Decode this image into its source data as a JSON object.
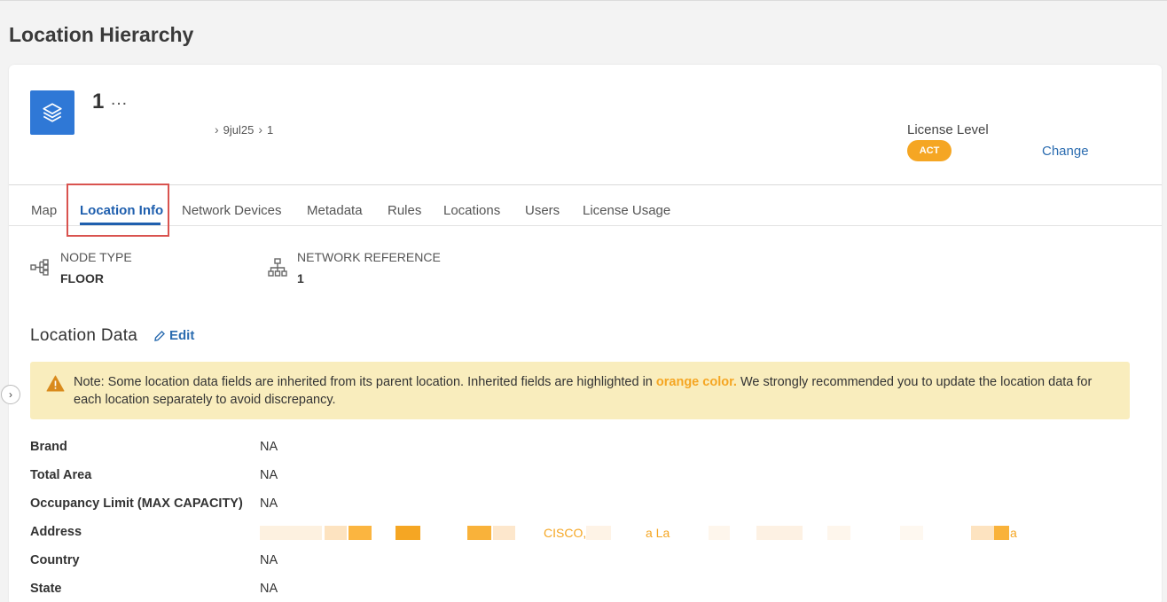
{
  "page": {
    "title": "Location Hierarchy"
  },
  "location": {
    "name": "1",
    "more_label": "…",
    "breadcrumb": [
      "9jul25",
      "1"
    ],
    "icon": "layers-icon"
  },
  "license": {
    "label": "License Level",
    "badge": "ACT",
    "change_label": "Change"
  },
  "tabs": [
    {
      "label": "Map"
    },
    {
      "label": "Location Info",
      "active": true
    },
    {
      "label": "Network Devices"
    },
    {
      "label": "Metadata"
    },
    {
      "label": "Rules"
    },
    {
      "label": "Locations"
    },
    {
      "label": "Users"
    },
    {
      "label": "License Usage"
    }
  ],
  "node_info": {
    "node_type_label": "NODE TYPE",
    "node_type_value": "FLOOR",
    "network_ref_label": "NETWORK REFERENCE",
    "network_ref_value": "1"
  },
  "location_data": {
    "title": "Location Data",
    "edit_label": "Edit",
    "note_prefix": "Note: Some location data fields are inherited from its parent location. Inherited fields are highlighted in ",
    "note_highlight": "orange color.",
    "note_suffix": " We strongly recommended you to update the location data for each location separately to avoid discrepancy.",
    "rows": [
      {
        "label": "Brand",
        "value": "NA"
      },
      {
        "label": "Total Area",
        "value": "NA"
      },
      {
        "label": "Occupancy Limit (MAX CAPACITY)",
        "value": "NA"
      },
      {
        "label": "Address",
        "value": ""
      },
      {
        "label": "Country",
        "value": "NA"
      },
      {
        "label": "State",
        "value": "NA"
      }
    ],
    "address_fragments": [
      "CISCO,",
      "a La",
      "a"
    ]
  },
  "colors": {
    "accent": "#1f5fae",
    "tile": "#2f78d6",
    "badge": "#f5a623",
    "note_bg": "#f9edbd",
    "inherited": "#f5a623"
  }
}
